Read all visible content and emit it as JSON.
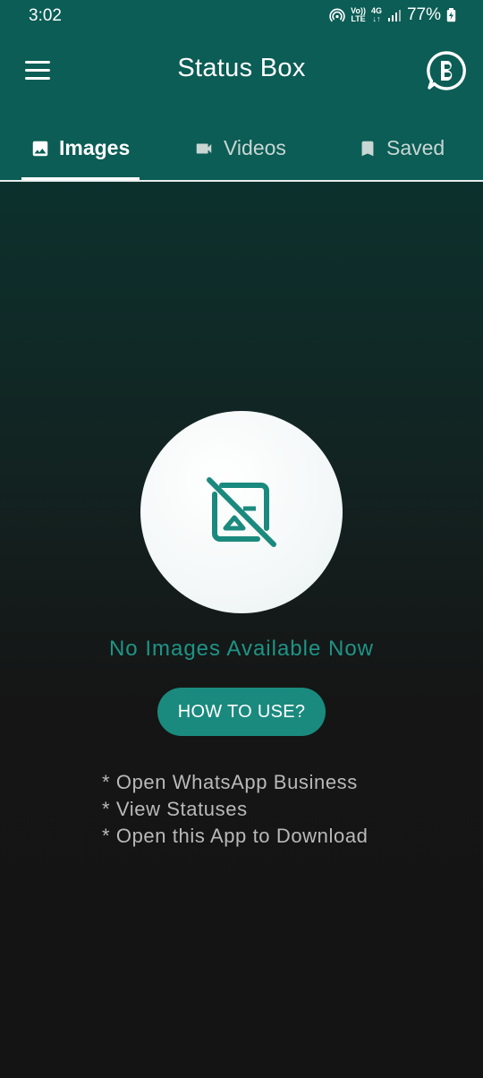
{
  "status_bar": {
    "time": "3:02",
    "volte_top": "Vo))",
    "volte_bottom": "LTE",
    "network_top": "4G",
    "network_bottom": "↓↑",
    "battery": "77%"
  },
  "app_bar": {
    "title": "Status Box",
    "menu_icon": "hamburger-menu-icon",
    "business_icon": "whatsapp-business-icon"
  },
  "tabs": [
    {
      "label": "Images",
      "icon": "image-icon",
      "active": true
    },
    {
      "label": "Videos",
      "icon": "video-camera-icon",
      "active": false
    },
    {
      "label": "Saved",
      "icon": "bookmark-icon",
      "active": false
    }
  ],
  "empty_state": {
    "icon": "image-off-icon",
    "message": "No Images Available Now",
    "button_label": "HOW TO USE?",
    "steps": [
      "* Open WhatsApp Business",
      "* View Statuses",
      "* Open this App to Download"
    ]
  },
  "colors": {
    "header": "#0b5d55",
    "accent": "#1b8a7e",
    "message": "#1f9486",
    "background": "#141414"
  }
}
